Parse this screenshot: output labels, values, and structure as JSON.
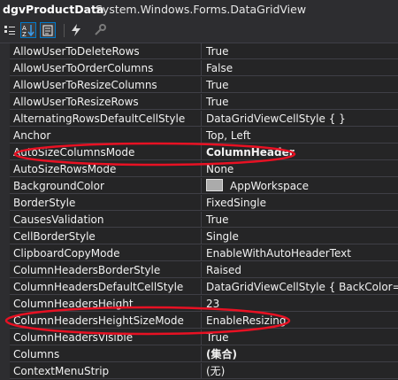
{
  "header": {
    "object_name": "dgvProductData",
    "type_name": "System.Windows.Forms.DataGridView"
  },
  "toolbar": {
    "buttons": [
      "categorized-icon",
      "alphabetical-icon",
      "properties-icon",
      "events-icon",
      "property-pages-icon"
    ]
  },
  "properties": [
    {
      "name": "AllowUserToDeleteRows",
      "value": "True"
    },
    {
      "name": "AllowUserToOrderColumns",
      "value": "False"
    },
    {
      "name": "AllowUserToResizeColumns",
      "value": "True"
    },
    {
      "name": "AllowUserToResizeRows",
      "value": "True"
    },
    {
      "name": "AlternatingRowsDefaultCellStyle",
      "value": "DataGridViewCellStyle { }"
    },
    {
      "name": "Anchor",
      "value": "Top, Left"
    },
    {
      "name": "AutoSizeColumnsMode",
      "value": "ColumnHeader",
      "bold": true,
      "circled": true
    },
    {
      "name": "AutoSizeRowsMode",
      "value": "None"
    },
    {
      "name": "BackgroundColor",
      "value": "AppWorkspace",
      "swatch": "#ababab"
    },
    {
      "name": "BorderStyle",
      "value": "FixedSingle"
    },
    {
      "name": "CausesValidation",
      "value": "True"
    },
    {
      "name": "CellBorderStyle",
      "value": "Single"
    },
    {
      "name": "ClipboardCopyMode",
      "value": "EnableWithAutoHeaderText"
    },
    {
      "name": "ColumnHeadersBorderStyle",
      "value": "Raised"
    },
    {
      "name": "ColumnHeadersDefaultCellStyle",
      "value": "DataGridViewCellStyle { BackColor=C"
    },
    {
      "name": "ColumnHeadersHeight",
      "value": "23"
    },
    {
      "name": "ColumnHeadersHeightSizeMode",
      "value": "EnableResizing",
      "circled": true
    },
    {
      "name": "ColumnHeadersVisible",
      "value": "True"
    },
    {
      "name": "Columns",
      "value": "(集合)",
      "bold": true
    },
    {
      "name": "ContextMenuStrip",
      "value": "(无)"
    }
  ],
  "colors": {
    "background": "#252526",
    "highlight_ellipse": "#e81123"
  }
}
